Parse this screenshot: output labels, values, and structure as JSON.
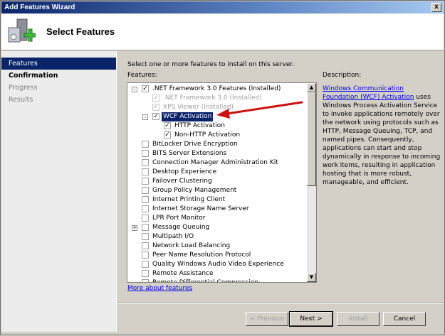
{
  "window": {
    "title": "Add Features Wizard",
    "close_label": "x"
  },
  "header": {
    "title": "Select Features",
    "icon": "server-add-icon"
  },
  "sidebar": {
    "items": [
      {
        "label": "Features",
        "state": "active"
      },
      {
        "label": "Confirmation",
        "state": "bold"
      },
      {
        "label": "Progress",
        "state": "dim"
      },
      {
        "label": "Results",
        "state": "dim"
      }
    ]
  },
  "main": {
    "intro": "Select one or more features to install on this server.",
    "features_label": "Features:",
    "tree": [
      {
        "label": ".NET Framework 3.0 Features  (Installed)",
        "level": 0,
        "checked": true,
        "disabled": false,
        "expander": "-"
      },
      {
        "label": ".NET Framework 3.0  (Installed)",
        "level": 1,
        "checked": true,
        "disabled": true
      },
      {
        "label": "XPS Viewer  (Installed)",
        "level": 1,
        "checked": true,
        "disabled": true
      },
      {
        "label": "WCF Activation",
        "level": 1,
        "checked": true,
        "disabled": false,
        "expander": "-",
        "selected": true
      },
      {
        "label": "HTTP Activation",
        "level": 2,
        "checked": true,
        "disabled": false
      },
      {
        "label": "Non-HTTP Activation",
        "level": 2,
        "checked": true,
        "disabled": false
      },
      {
        "label": "BitLocker Drive Encryption",
        "level": 0,
        "checked": false
      },
      {
        "label": "BITS Server Extensions",
        "level": 0,
        "checked": false
      },
      {
        "label": "Connection Manager Administration Kit",
        "level": 0,
        "checked": false
      },
      {
        "label": "Desktop Experience",
        "level": 0,
        "checked": false
      },
      {
        "label": "Failover Clustering",
        "level": 0,
        "checked": false
      },
      {
        "label": "Group Policy Management",
        "level": 0,
        "checked": false
      },
      {
        "label": "Internet Printing Client",
        "level": 0,
        "checked": false
      },
      {
        "label": "Internet Storage Name Server",
        "level": 0,
        "checked": false
      },
      {
        "label": "LPR Port Monitor",
        "level": 0,
        "checked": false
      },
      {
        "label": "Message Queuing",
        "level": 0,
        "checked": false,
        "expander": "+"
      },
      {
        "label": "Multipath I/O",
        "level": 0,
        "checked": false
      },
      {
        "label": "Network Load Balancing",
        "level": 0,
        "checked": false
      },
      {
        "label": "Peer Name Resolution Protocol",
        "level": 0,
        "checked": false
      },
      {
        "label": "Quality Windows Audio Video Experience",
        "level": 0,
        "checked": false
      },
      {
        "label": "Remote Assistance",
        "level": 0,
        "checked": false
      },
      {
        "label": "Remote Differential Compression",
        "level": 0,
        "checked": false
      }
    ],
    "description_label": "Description:",
    "description_link": "Windows Communication Foundation (WCF) Activation",
    "description_text": " uses Windows Process Activation Service to invoke applications remotely over the network using protocols such as HTTP, Message Queuing, TCP, and named pipes. Consequently, applications can start and stop dynamically in response to incoming work items, resulting in application hosting that is more robust, manageable, and efficient.",
    "more_link": "More about features",
    "annotation_color": "#cc1111"
  },
  "buttons": {
    "previous": "< Previous",
    "next": "Next >",
    "install": "Install",
    "cancel": "Cancel"
  }
}
